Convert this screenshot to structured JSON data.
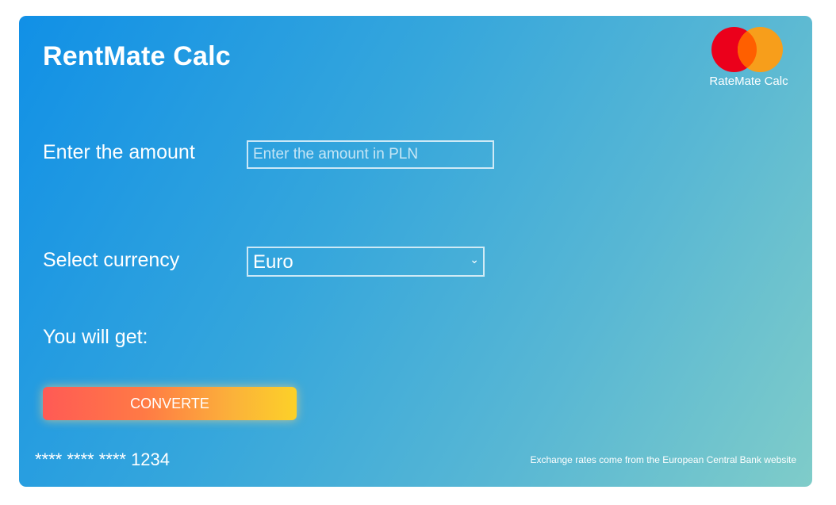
{
  "app": {
    "title": "RentMate Calc"
  },
  "logo": {
    "label": "RateMate Calc",
    "colors": {
      "left": "#eb001b",
      "right": "#f79e1b",
      "overlap": "#ff5f00"
    }
  },
  "form": {
    "amount_label": "Enter the amount",
    "amount_value": "",
    "amount_placeholder": "Enter the amount in PLN",
    "currency_label": "Select currency",
    "currency_selected": "Euro",
    "result_label": "You will get:",
    "convert_label": "CONVERTE"
  },
  "footer": {
    "card_number": "**** **** **** 1234",
    "note": "Exchange rates come from the European Central Bank website"
  },
  "colors": {
    "gradient_start": "#1190e6",
    "gradient_end": "#7fccc9",
    "button_start": "#ff5a55",
    "button_end": "#fcd128"
  }
}
